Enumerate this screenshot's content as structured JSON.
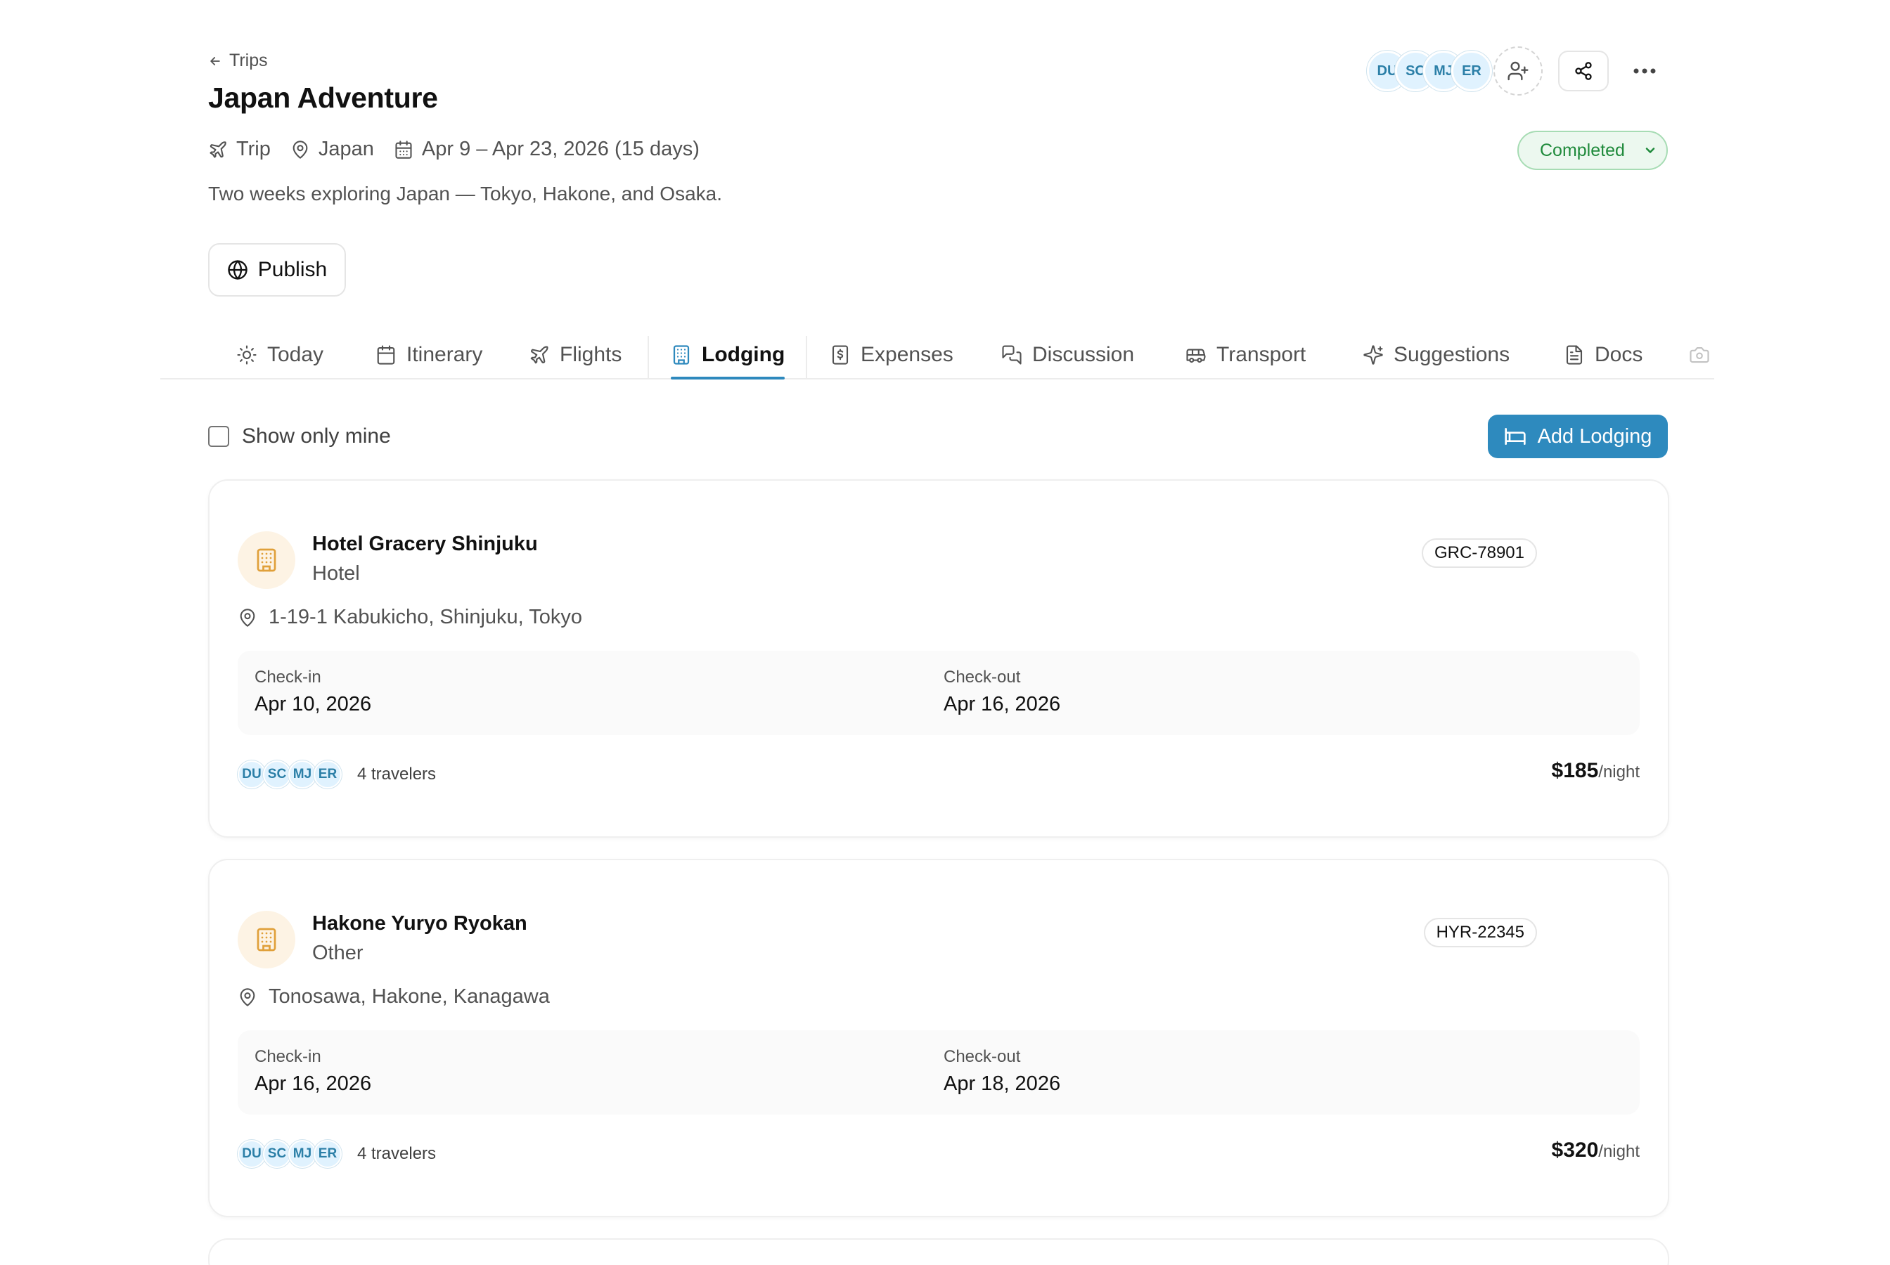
{
  "header": {
    "back_label": "Trips",
    "title": "Japan Adventure",
    "meta": {
      "type": "Trip",
      "location": "Japan",
      "dates": "Apr 9 – Apr 23, 2026 (15 days)"
    },
    "description": "Two weeks exploring Japan — Tokyo, Hakone, and Osaka.",
    "publish_label": "Publish",
    "collaborators": [
      "DU",
      "SC",
      "MJ",
      "ER"
    ],
    "status": "Completed"
  },
  "tabs": [
    {
      "label": "Today",
      "icon": "sun-icon"
    },
    {
      "label": "Itinerary",
      "icon": "calendar-icon"
    },
    {
      "label": "Flights",
      "icon": "plane-icon"
    },
    {
      "label": "Lodging",
      "icon": "building-icon",
      "active": true
    },
    {
      "label": "Expenses",
      "icon": "receipt-icon"
    },
    {
      "label": "Discussion",
      "icon": "chat-icon"
    },
    {
      "label": "Transport",
      "icon": "bus-icon"
    },
    {
      "label": "Suggestions",
      "icon": "sparkles-icon"
    },
    {
      "label": "Docs",
      "icon": "document-icon"
    }
  ],
  "filter": {
    "show_only_mine_label": "Show only mine",
    "add_lodging_label": "Add Lodging"
  },
  "lodgings": [
    {
      "name": "Hotel Gracery Shinjuku",
      "type": "Hotel",
      "confirmation": "GRC-78901",
      "address": "1-19-1 Kabukicho, Shinjuku, Tokyo",
      "checkin_label": "Check-in",
      "checkin": "Apr 10, 2026",
      "checkout_label": "Check-out",
      "checkout": "Apr 16, 2026",
      "travelers": [
        "DU",
        "SC",
        "MJ",
        "ER"
      ],
      "travelers_label": "4 travelers",
      "price": "$185",
      "price_unit": "/night"
    },
    {
      "name": "Hakone Yuryo Ryokan",
      "type": "Other",
      "confirmation": "HYR-22345",
      "address": "Tonosawa, Hakone, Kanagawa",
      "checkin_label": "Check-in",
      "checkin": "Apr 16, 2026",
      "checkout_label": "Check-out",
      "checkout": "Apr 18, 2026",
      "travelers": [
        "DU",
        "SC",
        "MJ",
        "ER"
      ],
      "travelers_label": "4 travelers",
      "price": "$320",
      "price_unit": "/night"
    }
  ],
  "colors": {
    "accent": "#2e8abe",
    "status_green": "#1f8a3b",
    "lodging_icon": "#e0a03a",
    "avatar_bg": "#e0f2fe"
  }
}
